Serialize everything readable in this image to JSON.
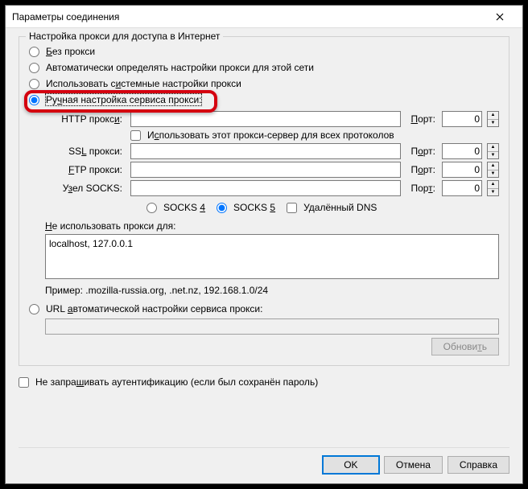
{
  "window": {
    "title": "Параметры соединения"
  },
  "fieldset": {
    "legend": "Настройка прокси для доступа в Интернет"
  },
  "radios": {
    "no_proxy": "Без прокси",
    "auto_detect": "Автоматически определять настройки прокси для этой сети",
    "system": "Использовать системные настройки прокси",
    "manual": "Ручная настройка сервиса прокси:",
    "pac": "URL автоматической настройки сервиса прокси:"
  },
  "proxy": {
    "http_label": "HTTP прокси:",
    "ssl_label": "SSL прокси:",
    "ftp_label": "FTP прокси:",
    "socks_label": "Узел SOCKS:",
    "port_label": "Порт:",
    "port_value": "0",
    "share_label": "Использовать этот прокси-сервер для всех протоколов",
    "socks4": "SOCKS 4",
    "socks5": "SOCKS 5",
    "remote_dns": "Удалённый DNS"
  },
  "noproxy": {
    "label": "Не использовать прокси для:",
    "value": "localhost, 127.0.0.1",
    "example": "Пример: .mozilla-russia.org, .net.nz, 192.168.1.0/24"
  },
  "buttons": {
    "reload": "Обновить",
    "ok": "OK",
    "cancel": "Отмена",
    "help": "Справка"
  },
  "auth": {
    "label": "Не запрашивать аутентификацию (если был сохранён пароль)"
  }
}
